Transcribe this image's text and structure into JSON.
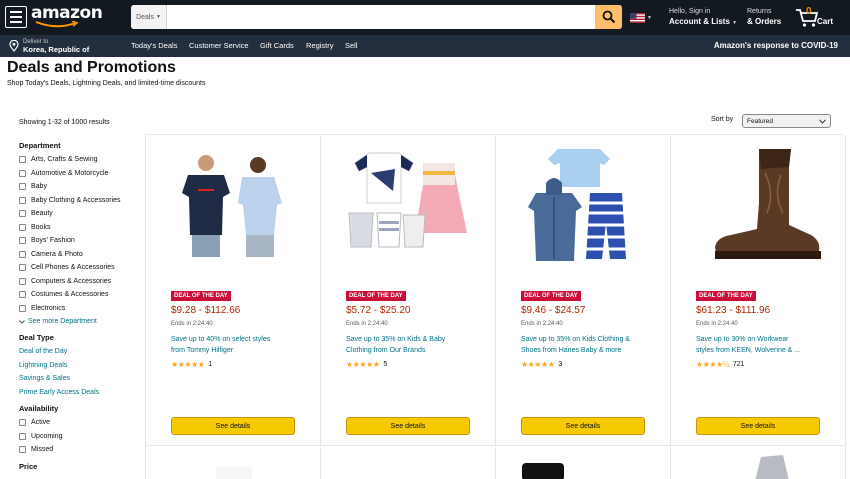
{
  "nav": {
    "logo": "amazon",
    "search_category": "Deals",
    "search_placeholder": "",
    "signin_small": "Hello, Sign in",
    "signin_big": "Account & Lists",
    "returns_small": "Returns",
    "returns_big": "& Orders",
    "cart_count": "0",
    "cart_label": "Cart"
  },
  "subnav": {
    "deliver_line1": "Deliver to",
    "deliver_line2": "Korea, Republic of",
    "items": [
      "Today's Deals",
      "Customer Service",
      "Gift Cards",
      "Registry",
      "Sell"
    ],
    "covid": "Amazon's response to COVID-19"
  },
  "page": {
    "title": "Deals and Promotions",
    "subtitle": "Shop Today's Deals, Lightning Deals, and limited-time discounts",
    "results": "Showing 1-32 of 1000 results",
    "sort_label": "Sort by",
    "sort_value": "Featured"
  },
  "sidebar": {
    "department_heading": "Department",
    "departments": [
      "Arts, Crafts & Sewing",
      "Automotive & Motorcycle",
      "Baby",
      "Baby Clothing & Accessories",
      "Beauty",
      "Books",
      "Boys' Fashion",
      "Camera & Photo",
      "Cell Phones & Accessories",
      "Computers & Accessories",
      "Costumes & Accessories",
      "Electronics"
    ],
    "see_more": "See more Department",
    "deal_type_heading": "Deal Type",
    "deal_types": [
      "Deal of the Day",
      "Lightning Deals",
      "Savings & Sales",
      "Prime Early Access Deals"
    ],
    "availability_heading": "Availability",
    "availability": [
      "Active",
      "Upcoming",
      "Missed"
    ],
    "price_heading": "Price"
  },
  "deals": [
    {
      "badge": "DEAL OF THE DAY",
      "price": "$9.28 - $112.66",
      "ends": "Ends in 2:24:40",
      "desc1": "Save up to 40% on select styles",
      "desc2": "from Tommy Hilfiger",
      "stars": "★★★★★",
      "reviews": "1",
      "button": "See details"
    },
    {
      "badge": "DEAL OF THE DAY",
      "price": "$5.72 - $25.20",
      "ends": "Ends in 2:24:40",
      "desc1": "Save up to 35% on Kids & Baby",
      "desc2": "Clothing from Our Brands",
      "stars": "★★★★★",
      "reviews": "5",
      "button": "See details"
    },
    {
      "badge": "DEAL OF THE DAY",
      "price": "$9.46 - $24.57",
      "ends": "Ends in 2:24:40",
      "desc1": "Save up to 35% on Kids Clothing &",
      "desc2": "Shoes from Hanes Baby & more",
      "stars": "★★★★★",
      "reviews": "3",
      "button": "See details"
    },
    {
      "badge": "DEAL OF THE DAY",
      "price": "$61.23 - $111.96",
      "ends": "Ends in 2:24:40",
      "desc1": "Save up to 30% on Workwear",
      "desc2": "styles from KEEN, Wolverine & ...",
      "stars": "★★★★½",
      "reviews": "721",
      "button": "See details"
    }
  ],
  "colors": {
    "nav_bg": "#131921",
    "subnav_bg": "#232f3e",
    "search_btn": "#febd69",
    "badge": "#cc0c39",
    "price": "#b12704",
    "link": "#007185",
    "button": "#f7ca00"
  }
}
